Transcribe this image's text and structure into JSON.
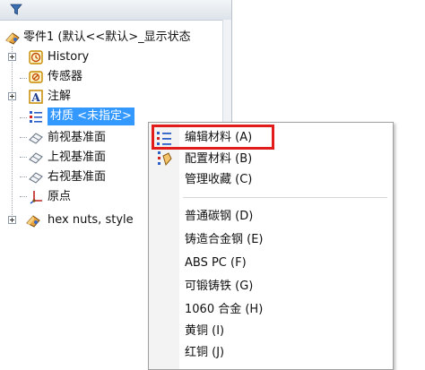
{
  "tree": {
    "filter_icon": "funnel-icon",
    "root": "零件1 (默认<<默认>_显示状态",
    "items": [
      {
        "label": "History",
        "icon": "history-icon"
      },
      {
        "label": "传感器",
        "icon": "sensor-icon"
      },
      {
        "label": "注解",
        "icon": "annotation-icon"
      },
      {
        "label": "材质 <未指定>",
        "icon": "material-icon"
      },
      {
        "label": "前视基准面",
        "icon": "plane-icon"
      },
      {
        "label": "上视基准面",
        "icon": "plane-icon"
      },
      {
        "label": "右视基准面",
        "icon": "plane-icon"
      },
      {
        "label": "原点",
        "icon": "origin-icon"
      },
      {
        "label": "hex nuts, style",
        "icon": "feature-icon"
      }
    ]
  },
  "menu": {
    "items": [
      {
        "label": "编辑材料 (A)",
        "icon": "edit-material-icon"
      },
      {
        "label": "配置材料 (B)",
        "icon": "configure-material-icon"
      },
      {
        "label": "管理收藏 (C)"
      },
      {
        "label": "普通碳钢 (D)"
      },
      {
        "label": "铸造合金钢 (E)"
      },
      {
        "label": "ABS PC (F)"
      },
      {
        "label": "可锻铸铁 (G)"
      },
      {
        "label": "1060 合金 (H)"
      },
      {
        "label": "黄铜 (I)"
      },
      {
        "label": "红铜 (J)"
      }
    ]
  },
  "colors": {
    "selection": "#3399ff",
    "highlight_border": "#e21b1b"
  }
}
